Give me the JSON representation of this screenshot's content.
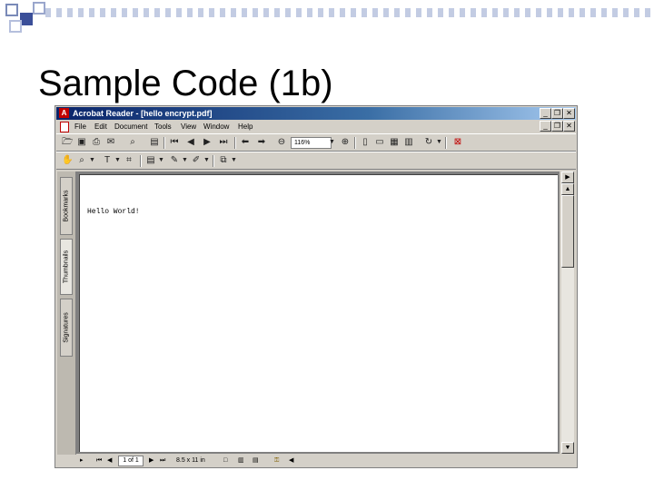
{
  "slide": {
    "title": "Sample Code (1b)"
  },
  "window": {
    "title": "Acrobat Reader - [hello encrypt.pdf]",
    "controls": {
      "minimize": "_",
      "restore": "❐",
      "close": "✕"
    },
    "doc_controls": {
      "minimize": "_",
      "restore": "❐",
      "close": "✕"
    }
  },
  "menu": [
    "File",
    "Edit",
    "Document",
    "Tools",
    "View",
    "Window",
    "Help"
  ],
  "toolbar": {
    "zoom_value": "116%"
  },
  "side_tabs": {
    "bookmarks": "Bookmarks",
    "thumbnails": "Thumbnails",
    "signatures": "Signatures"
  },
  "document": {
    "text": "Hello World!"
  },
  "status": {
    "page": "1 of 1",
    "page_size": "8.5 x 11 in"
  },
  "colors": {
    "titlebar_start": "#0a246a",
    "titlebar_end": "#a6caf0",
    "chrome": "#d4d0c8",
    "page_bg": "#808080"
  }
}
